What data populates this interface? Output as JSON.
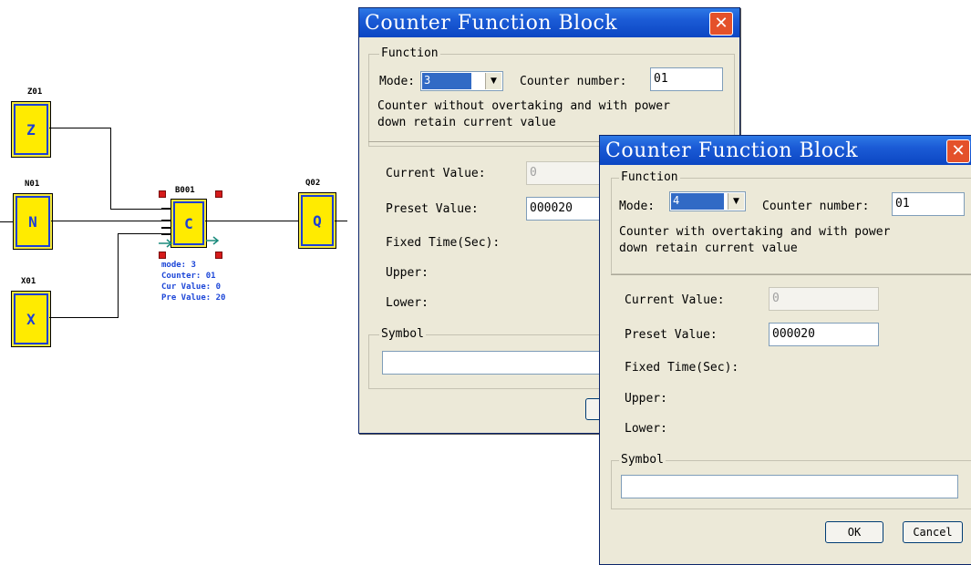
{
  "diagram": {
    "blocks": [
      {
        "id": "z01",
        "label": "Z01",
        "letter": "Z"
      },
      {
        "id": "n01",
        "label": "N01",
        "letter": "N"
      },
      {
        "id": "x01",
        "label": "X01",
        "letter": "X"
      },
      {
        "id": "b001",
        "label": "B001",
        "letter": "C"
      },
      {
        "id": "q02",
        "label": "Q02",
        "letter": "Q"
      }
    ],
    "b001_info": {
      "mode": "mode: 3",
      "counter": "Counter: 01",
      "cur": "Cur Value: 0",
      "pre": "Pre Value: 20"
    }
  },
  "dialog_back": {
    "title": "Counter Function Block",
    "close": "✕",
    "function_legend": "Function",
    "mode_label": "Mode:",
    "mode_value": "3",
    "counter_number_label": "Counter number:",
    "counter_number_value": "01",
    "description_line1": "Counter without overtaking and with power",
    "description_line2": "down retain current value",
    "current_value_label": "Current Value:",
    "current_value": "0",
    "preset_value_label": "Preset Value:",
    "preset_value": "000020",
    "fixed_time_label": "Fixed Time(Sec):",
    "upper_label": "Upper:",
    "lower_label": "Lower:",
    "symbol_legend": "Symbol",
    "symbol_value": ""
  },
  "dialog_front": {
    "title": "Counter Function Block",
    "close": "✕",
    "function_legend": "Function",
    "mode_label": "Mode:",
    "mode_value": "4",
    "counter_number_label": "Counter number:",
    "counter_number_value": "01",
    "description_line1": "Counter with overtaking and with power",
    "description_line2": "down retain current value",
    "current_value_label": "Current Value:",
    "current_value": "0",
    "preset_value_label": "Preset Value:",
    "preset_value": "000020",
    "fixed_time_label": "Fixed Time(Sec):",
    "upper_label": "Upper:",
    "lower_label": "Lower:",
    "symbol_legend": "Symbol",
    "symbol_value": "",
    "ok_label": "OK",
    "cancel_label": "Cancel"
  },
  "colors": {
    "block_face": "#ffeb00",
    "block_border": "#1c3fd6",
    "info_text": "#1d47d8",
    "title_bar": "#1b5bd6",
    "close_button": "#e4512a",
    "dialog_bg": "#ece9d8"
  },
  "icons": {
    "close": "close-icon",
    "dropdown": "chevron-down-icon",
    "selection_handle": "resize-handle-icon",
    "flow_arrow": "arrow-right-icon"
  }
}
